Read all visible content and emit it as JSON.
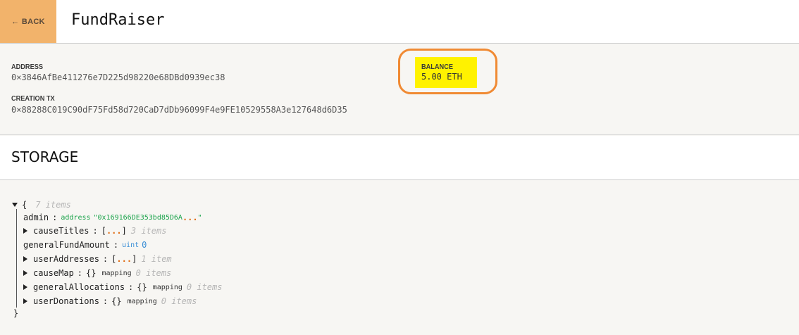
{
  "header": {
    "back_label": "← BACK",
    "title": "FundRaiser"
  },
  "contract": {
    "address_label": "ADDRESS",
    "address": "0×3846AfBe411276e7D225d98220e68DBd0939ec38",
    "creation_tx_label": "CREATION TX",
    "creation_tx": "0×88288C019C90dF75Fd58d720CaD7dDb96099F4e9FE10529558A3e127648d6D35",
    "balance_label": "BALANCE",
    "balance": "5.00 ETH"
  },
  "storage": {
    "title": "STORAGE",
    "open_brace": "{",
    "close_brace": "}",
    "item_count": "7 items",
    "entries": [
      {
        "key": "admin",
        "type": "address",
        "value": "\"0x169166DE353bd85D6A",
        "dots": "...",
        "end": "\""
      },
      {
        "key": "causeTitles",
        "open": "[",
        "dots": "...",
        "close": "]",
        "count": "3 items"
      },
      {
        "key": "generalFundAmount",
        "type": "uint",
        "value": "0"
      },
      {
        "key": "userAddresses",
        "open": "[",
        "dots": "...",
        "close": "]",
        "count": "1 item"
      },
      {
        "key": "causeMap",
        "open": "{}",
        "type": "mapping",
        "count": "0 items"
      },
      {
        "key": "generalAllocations",
        "open": "{}",
        "type": "mapping",
        "count": "0 items"
      },
      {
        "key": "userDonations",
        "open": "{}",
        "type": "mapping",
        "count": "0 items"
      }
    ]
  },
  "colors": {
    "back_button": "#f2b36b",
    "balance_highlight": "#fff200",
    "annotation_ring": "#f08a33"
  }
}
